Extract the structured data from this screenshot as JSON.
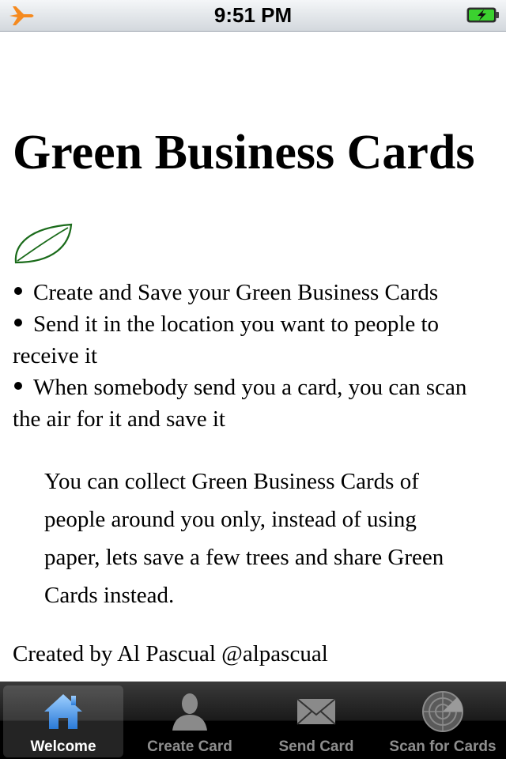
{
  "status_bar": {
    "time": "9:51 PM",
    "left_icon": "airplane-icon",
    "right_icon": "battery-charging-icon"
  },
  "content": {
    "title": "Green Business Cards",
    "leaf_icon": "leaf-icon",
    "bullets": [
      "Create and Save your Green Business Cards",
      "Send it in the location you want to people to receive it",
      "When somebody send you a card, you can scan the air for it and save it"
    ],
    "paragraph": "You can collect Green Business Cards of people around you only, instead of using paper, lets save a few trees and share Green Cards instead.",
    "credit": "Created by Al Pascual @alpascual"
  },
  "tab_bar": {
    "tabs": [
      {
        "label": "Welcome",
        "icon": "house-icon",
        "selected": true
      },
      {
        "label": "Create Card",
        "icon": "person-icon",
        "selected": false
      },
      {
        "label": "Send Card",
        "icon": "envelope-icon",
        "selected": false
      },
      {
        "label": "Scan for Cards",
        "icon": "radar-icon",
        "selected": false
      }
    ]
  },
  "colors": {
    "leaf_green": "#1a6b1a",
    "tab_selected_blue": "#5aa7ee",
    "tab_bar_black": "#000000",
    "battery_green": "#3bd12f"
  }
}
